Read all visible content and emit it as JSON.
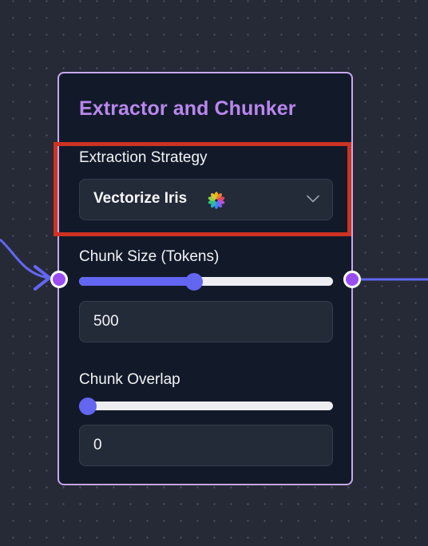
{
  "node": {
    "title": "Extractor and Chunker",
    "border_color": "#c7a7ec",
    "title_color": "#b987ec"
  },
  "extraction_strategy": {
    "label": "Extraction Strategy",
    "selected": "Vectorize Iris",
    "icon": "pinwheel-flower-icon",
    "dropdown_icon": "chevron-down-icon"
  },
  "chunk_size": {
    "label": "Chunk Size (Tokens)",
    "value": "500",
    "slider_fraction": 0.45
  },
  "chunk_overlap": {
    "label": "Chunk Overlap",
    "value": "0",
    "slider_fraction": 0.0
  },
  "colors": {
    "canvas_background": "#252a36",
    "node_background": "#121a2a",
    "accent": "#6366f1",
    "handle": "#9a4ef1",
    "highlight": "#cd3222"
  }
}
